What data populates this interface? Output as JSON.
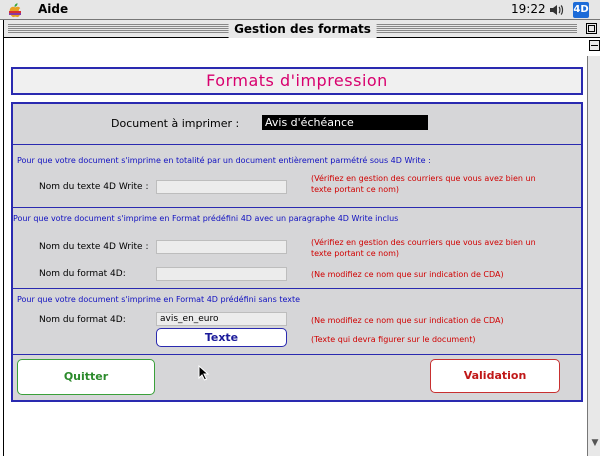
{
  "menubar": {
    "app_menu": "Aide",
    "clock": "19:22",
    "app_badge": "4D"
  },
  "window": {
    "title": "Gestion des formats"
  },
  "form": {
    "title": "Formats d'impression",
    "doc_label": "Document à imprimer :",
    "doc_value": "Avis d'échéance",
    "section1": {
      "header": "Pour que votre document s'imprime en totalité par un document entièrement parmétré sous 4D Write :",
      "label_text": "Nom du texte 4D Write :",
      "note_line1": "(Vérifiez en gestion des courriers que vous avez bien un",
      "note_line2": "texte portant ce nom)"
    },
    "section2": {
      "header": "Pour que votre document s'imprime en Format prédéfini 4D avec un paragraphe 4D Write inclus",
      "label_text": "Nom du texte 4D Write :",
      "note_text_line1": "(Vérifiez en gestion des courriers que vous avez bien un",
      "note_text_line2": "texte portant ce nom)",
      "label_format": "Nom du format 4D:",
      "note_format": "(Ne modifiez ce nom que sur indication de CDA)"
    },
    "section3": {
      "header": "Pour que votre document s'imprime en Format 4D prédéfini sans texte",
      "label_format": "Nom du format 4D:",
      "format_value": "avis_en_euro",
      "note_format": "(Ne modifiez ce nom que sur indication de CDA)",
      "text_button": "Texte",
      "note_text": "(Texte qui devra figurer sur le document)"
    },
    "quit_button": "Quitter",
    "validate_button": "Validation"
  },
  "colors": {
    "accent_border": "#2a2ab0",
    "title_pink": "#d8006e",
    "quit_green": "#2b8a2b",
    "validate_red": "#c01818",
    "note_red": "#d00000",
    "panel_gray": "#d6d6d8"
  }
}
